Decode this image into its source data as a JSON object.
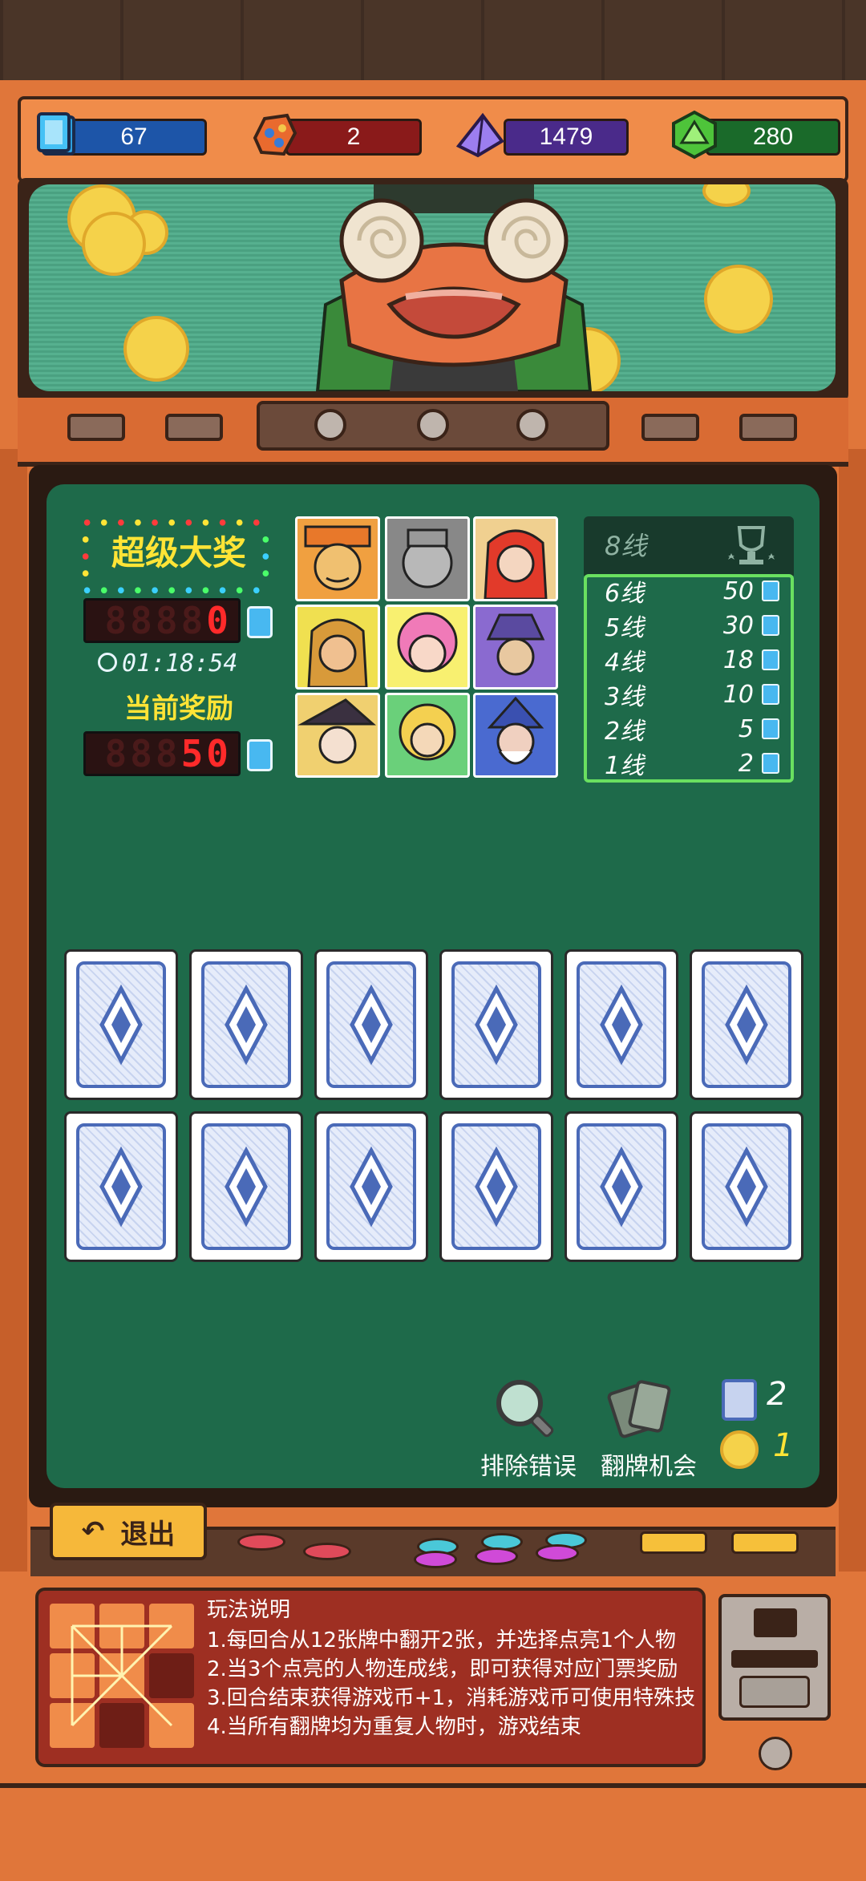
{
  "resources": {
    "cards": "67",
    "gems": "2",
    "crystals": "1479",
    "dice": "280"
  },
  "jackpot": {
    "title": "超级大奖",
    "super_value": "0",
    "super_ghost": "8888",
    "timer": "01:18:54",
    "current_label": "当前奖励",
    "current_value": "50",
    "current_ghost": "888"
  },
  "lines_table": {
    "header": "8线",
    "rows": [
      {
        "label": "6线",
        "value": "50"
      },
      {
        "label": "5线",
        "value": "30"
      },
      {
        "label": "4线",
        "value": "18"
      },
      {
        "label": "3线",
        "value": "10"
      },
      {
        "label": "2线",
        "value": "5"
      },
      {
        "label": "1线",
        "value": "2"
      }
    ]
  },
  "tools": {
    "eliminate_label": "排除错误",
    "flip_label": "翻牌机会",
    "card_count": "2",
    "coin_count": "1"
  },
  "exit_label": "退出",
  "instructions": {
    "title": "玩法说明",
    "lines": [
      "1.每回合从12张牌中翻开2张，并选择点亮1个人物",
      "2.当3个点亮的人物连成线，即可获得对应门票奖励",
      "3.回合结束获得游戏币+1，消耗游戏币可使用特殊技",
      "4.当所有翻牌均为重复人物时，游戏结束"
    ]
  },
  "colors": {
    "board": "#1e6a4a",
    "cabinet": "#e0763a",
    "jackpot_text": "#ffe436",
    "led_red": "#ff2a2a",
    "line_border": "#6ae060"
  }
}
